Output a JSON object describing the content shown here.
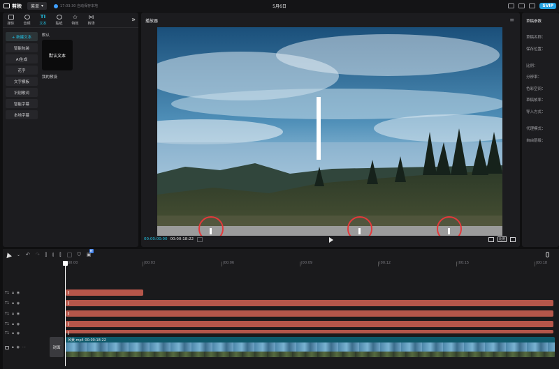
{
  "app": {
    "name": "剪映",
    "menu_label": "菜单",
    "save_status": "17:03:30 自动保存本地",
    "doc_title": "5月6日",
    "vip_label": "SVIP"
  },
  "tools": [
    {
      "label": "媒体",
      "icon": "media-icon"
    },
    {
      "label": "音频",
      "icon": "audio-icon"
    },
    {
      "label": "文本",
      "icon": "text-icon"
    },
    {
      "label": "贴纸",
      "icon": "sticker-icon"
    },
    {
      "label": "特效",
      "icon": "effects-icon"
    },
    {
      "label": "转场",
      "icon": "transition-icon"
    }
  ],
  "side_menu": [
    "+ 新建文本",
    "智能包装",
    "AI生成",
    "花字",
    "文字模板",
    "识别歌词",
    "智能字幕",
    "本地字幕"
  ],
  "library": {
    "section_default": "默认",
    "card_label": "默认文本",
    "section_presets": "我的预设"
  },
  "player": {
    "title": "播放器",
    "time_current": "00:00:00:00",
    "time_total": "00:00:18:22",
    "ratio_label": "比例"
  },
  "draft": {
    "title": "草稿参数",
    "rows": [
      "草稿名称：",
      "保存位置：",
      "比例：",
      "分辨率：",
      "色彩空间：",
      "草稿帧率：",
      "导入方式：",
      "代理模式：",
      "自由层级："
    ]
  },
  "timeline": {
    "ruler": [
      "00:00",
      "|00:03",
      "|00:06",
      "|00:09",
      "|00:12",
      "|00:15",
      "|00:18"
    ],
    "cover_label": "封面",
    "video_clip_label": "风景.mp4  00:00:18:22",
    "badge": "新"
  },
  "colors": {
    "accent": "#22c4e6",
    "text_clip": "#b5564a",
    "highlight_ring": "#e5393b"
  }
}
